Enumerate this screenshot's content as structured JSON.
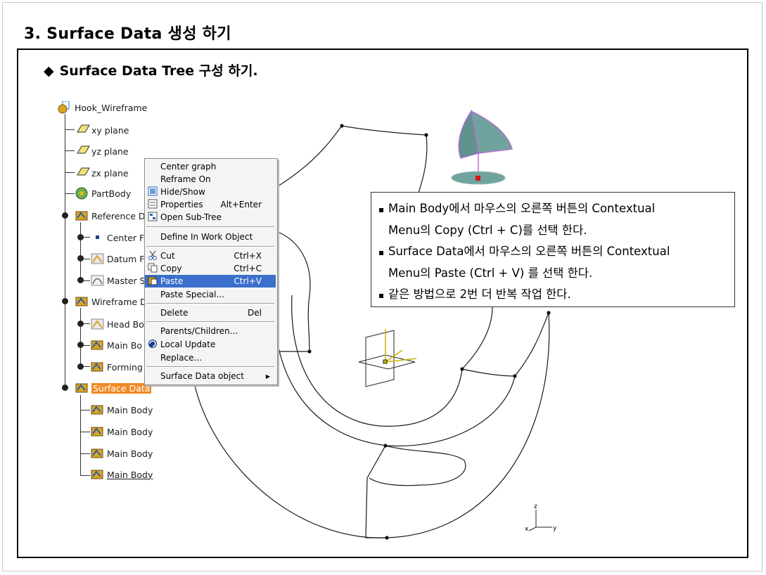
{
  "title": "3. Surface Data 생성 하기",
  "subtitle": {
    "bullet": "◆",
    "text": "Surface Data Tree 구성 하기."
  },
  "tree": {
    "root": "Hook_Wireframe",
    "items": [
      {
        "label": "xy plane",
        "icon": "plane-icon"
      },
      {
        "label": "yz plane",
        "icon": "plane-icon"
      },
      {
        "label": "zx plane",
        "icon": "plane-icon"
      },
      {
        "label": "PartBody",
        "icon": "partbody-icon"
      },
      {
        "label": "Reference D",
        "icon": "geometrical-set-icon"
      },
      {
        "label": "Center F",
        "icon": "point-icon"
      },
      {
        "label": "Datum F",
        "icon": "datum-icon"
      },
      {
        "label": "Master S",
        "icon": "sketch-icon"
      },
      {
        "label": "Wireframe D",
        "icon": "geometrical-set-icon"
      },
      {
        "label": "Head Bo",
        "icon": "datum-icon"
      },
      {
        "label": "Main Bo",
        "icon": "geometrical-set-icon"
      },
      {
        "label": "Forming",
        "icon": "geometrical-set-icon"
      },
      {
        "label": "Surface Data",
        "icon": "geometrical-set-icon"
      },
      {
        "label": "Main Body",
        "icon": "geometrical-set-icon"
      },
      {
        "label": "Main Body",
        "icon": "geometrical-set-icon"
      },
      {
        "label": "Main Body",
        "icon": "geometrical-set-icon"
      },
      {
        "label": "Main Body",
        "icon": "geometrical-set-icon"
      }
    ]
  },
  "context_menu": {
    "items": [
      {
        "label": "Center graph",
        "shortcut": ""
      },
      {
        "label": "Reframe On",
        "shortcut": ""
      },
      {
        "label": "Hide/Show",
        "shortcut": "",
        "icon": "hide-show-icon"
      },
      {
        "label": "Properties",
        "shortcut": "Alt+Enter",
        "icon": "properties-icon"
      },
      {
        "label": "Open Sub-Tree",
        "shortcut": "",
        "icon": "subtree-icon"
      },
      {
        "label": "Define In Work Object",
        "shortcut": ""
      },
      {
        "label": "Cut",
        "shortcut": "Ctrl+X",
        "icon": "scissors-icon"
      },
      {
        "label": "Copy",
        "shortcut": "Ctrl+C",
        "icon": "copy-icon"
      },
      {
        "label": "Paste",
        "shortcut": "Ctrl+V",
        "icon": "paste-icon"
      },
      {
        "label": "Paste Special...",
        "shortcut": ""
      },
      {
        "label": "Delete",
        "shortcut": "Del"
      },
      {
        "label": "Parents/Children...",
        "shortcut": ""
      },
      {
        "label": "Local Update",
        "shortcut": "",
        "icon": "update-icon"
      },
      {
        "label": "Replace...",
        "shortcut": ""
      },
      {
        "label": "Surface Data object",
        "shortcut": "",
        "submenu": true
      }
    ],
    "highlighted": "Paste"
  },
  "note": {
    "bullet": "▪",
    "lines": [
      {
        "text": "Main Body에서 마우스의 오른쪽 버튼의 Contextual",
        "cont": "Menu의 Copy (Ctrl + C)를 선택 한다."
      },
      {
        "text": "Surface Data에서 마우스의 오른쪽 버튼의 Contextual",
        "cont": "Menu의 Paste (Ctrl + V) 를 선택 한다."
      },
      {
        "text": "같은 방법으로 2번 더 반복 작업 한다.",
        "cont": ""
      }
    ]
  },
  "axes_labels": {
    "x": "x",
    "y": "y",
    "z": "z"
  },
  "colors": {
    "highlight": "#3b6fcb",
    "selected_node": "#f08a24",
    "surface": "#6fa39e"
  }
}
